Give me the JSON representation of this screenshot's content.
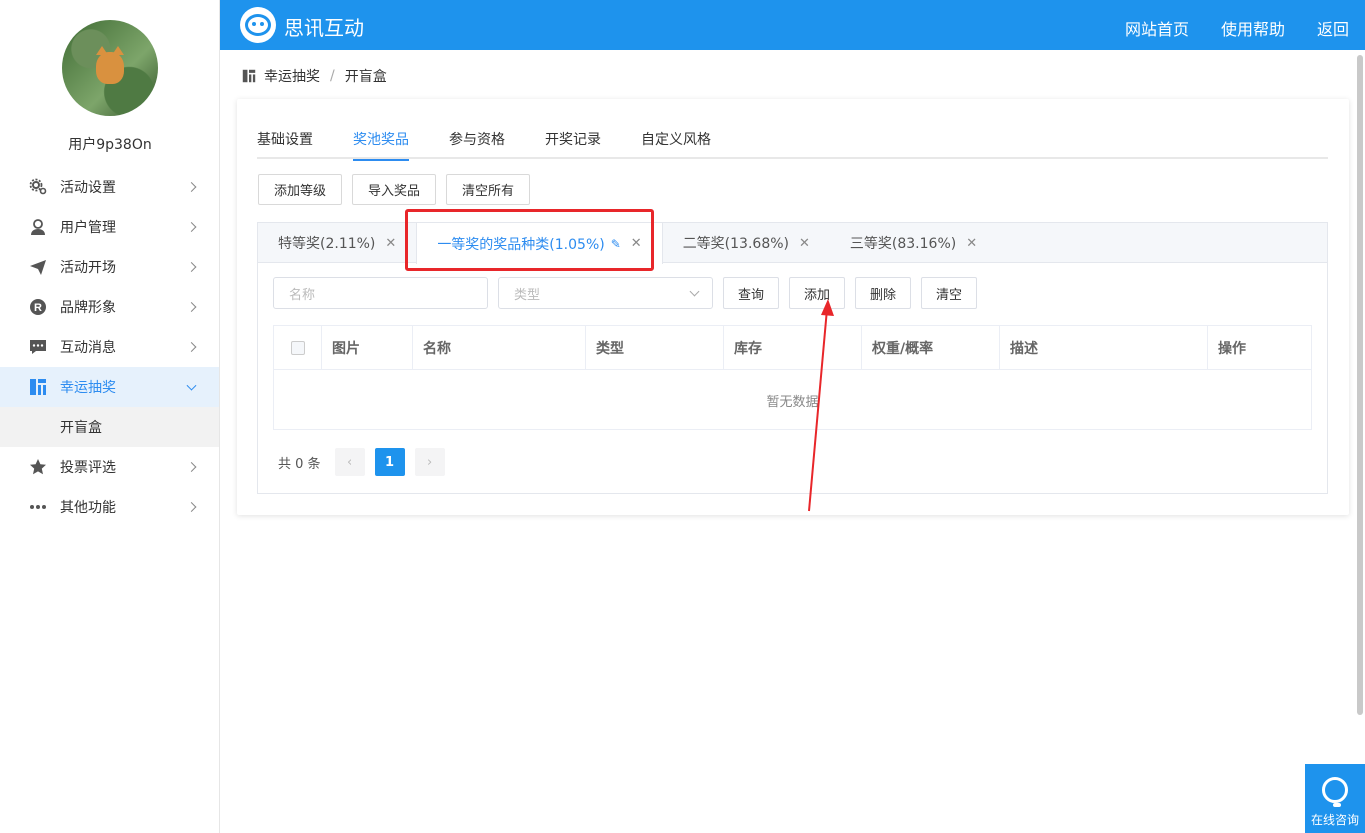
{
  "user": {
    "name": "用户9p38On"
  },
  "sidebar": {
    "items": [
      {
        "label": "活动设置",
        "icon": "gear-icon"
      },
      {
        "label": "用户管理",
        "icon": "user-icon"
      },
      {
        "label": "活动开场",
        "icon": "paper-plane-icon"
      },
      {
        "label": "品牌形象",
        "icon": "registered-icon"
      },
      {
        "label": "互动消息",
        "icon": "message-icon"
      },
      {
        "label": "幸运抽奖",
        "icon": "grid-icon",
        "active": true
      },
      {
        "label": "投票评选",
        "icon": "star-icon"
      },
      {
        "label": "其他功能",
        "icon": "more-icon"
      }
    ],
    "submenu": {
      "label": "开盲盒"
    }
  },
  "header": {
    "brand": "思讯互动",
    "nav": [
      "网站首页",
      "使用帮助",
      "返回"
    ]
  },
  "breadcrumb": {
    "parent": "幸运抽奖",
    "sep": "/",
    "current": "开盲盒"
  },
  "tabs": [
    "基础设置",
    "奖池奖品",
    "参与资格",
    "开奖记录",
    "自定义风格"
  ],
  "toolbar": [
    "添加等级",
    "导入奖品",
    "清空所有"
  ],
  "prize_tabs": [
    {
      "label": "特等奖(2.11%)"
    },
    {
      "label": "一等奖的奖品种类(1.05%)",
      "active": true
    },
    {
      "label": "二等奖(13.68%)"
    },
    {
      "label": "三等奖(83.16%)"
    }
  ],
  "filters": {
    "name_placeholder": "名称",
    "type_placeholder": "类型",
    "buttons": [
      "查询",
      "添加",
      "删除",
      "清空"
    ]
  },
  "table": {
    "columns": [
      "图片",
      "名称",
      "类型",
      "库存",
      "权重/概率",
      "描述",
      "操作"
    ],
    "empty_text": "暂无数据"
  },
  "pagination": {
    "total_text": "共 0 条",
    "current_page": "1"
  },
  "consult": {
    "label": "在线咨询"
  },
  "colors": {
    "primary": "#1e93ed",
    "highlight": "#e8262a"
  }
}
